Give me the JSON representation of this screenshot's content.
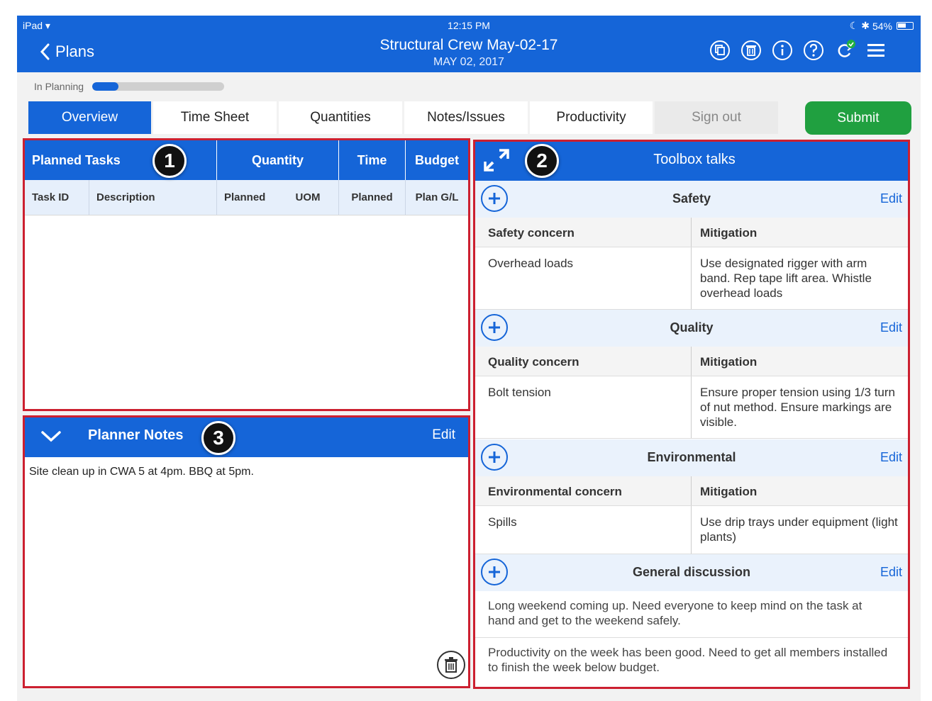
{
  "status_bar": {
    "device": "iPad",
    "time": "12:15 PM",
    "battery": "54%"
  },
  "header": {
    "back_label": "Plans",
    "title": "Structural Crew May-02-17",
    "date": "MAY 02, 2017",
    "icons": [
      "copy-icon",
      "delete-icon",
      "info-icon",
      "help-icon",
      "sync-icon",
      "menu-icon"
    ]
  },
  "plan_status": {
    "label": "In Planning",
    "progress_fraction": 0.2
  },
  "tabs": [
    {
      "label": "Overview",
      "active": true
    },
    {
      "label": "Time Sheet",
      "active": false
    },
    {
      "label": "Quantities",
      "active": false
    },
    {
      "label": "Notes/Issues",
      "active": false
    },
    {
      "label": "Productivity",
      "active": false
    },
    {
      "label": "Sign out",
      "active": false
    }
  ],
  "submit_label": "Submit",
  "planned_tasks": {
    "title": "Planned Tasks",
    "badge": "1",
    "group_headers": [
      "Quantity",
      "Time",
      "Budget"
    ],
    "columns": [
      "Task ID",
      "Description",
      "Planned",
      "UOM",
      "Planned",
      "Plan G/L"
    ],
    "rows": []
  },
  "planner_notes": {
    "title": "Planner Notes",
    "badge": "3",
    "edit_label": "Edit",
    "text": "Site clean up in CWA 5 at 4pm. BBQ at 5pm."
  },
  "toolbox": {
    "title": "Toolbox talks",
    "badge": "2",
    "sections": [
      {
        "title": "Safety",
        "edit_label": "Edit",
        "concern_header": "Safety concern",
        "mitigation_header": "Mitigation",
        "concern": "Overhead loads",
        "mitigation": "Use designated rigger with arm band. Rep tape lift area. Whistle overhead loads"
      },
      {
        "title": "Quality",
        "edit_label": "Edit",
        "concern_header": "Quality concern",
        "mitigation_header": "Mitigation",
        "concern": "Bolt tension",
        "mitigation": "Ensure proper tension using 1/3 turn of nut method. Ensure markings are visible."
      },
      {
        "title": "Environmental",
        "edit_label": "Edit",
        "concern_header": "Environmental concern",
        "mitigation_header": "Mitigation",
        "concern": "Spills",
        "mitigation": "Use drip trays under equipment (light plants)"
      }
    ],
    "general": {
      "title": "General discussion",
      "edit_label": "Edit",
      "items": [
        "Long weekend coming up. Need everyone to keep mind on the task at hand and get to the weekend safely.",
        "Productivity on the week has been good.  Need to get all members installed to finish the week below budget."
      ]
    }
  },
  "colors": {
    "primary": "#1565d8",
    "submit": "#20a040",
    "highlight_border": "#cc2030"
  }
}
